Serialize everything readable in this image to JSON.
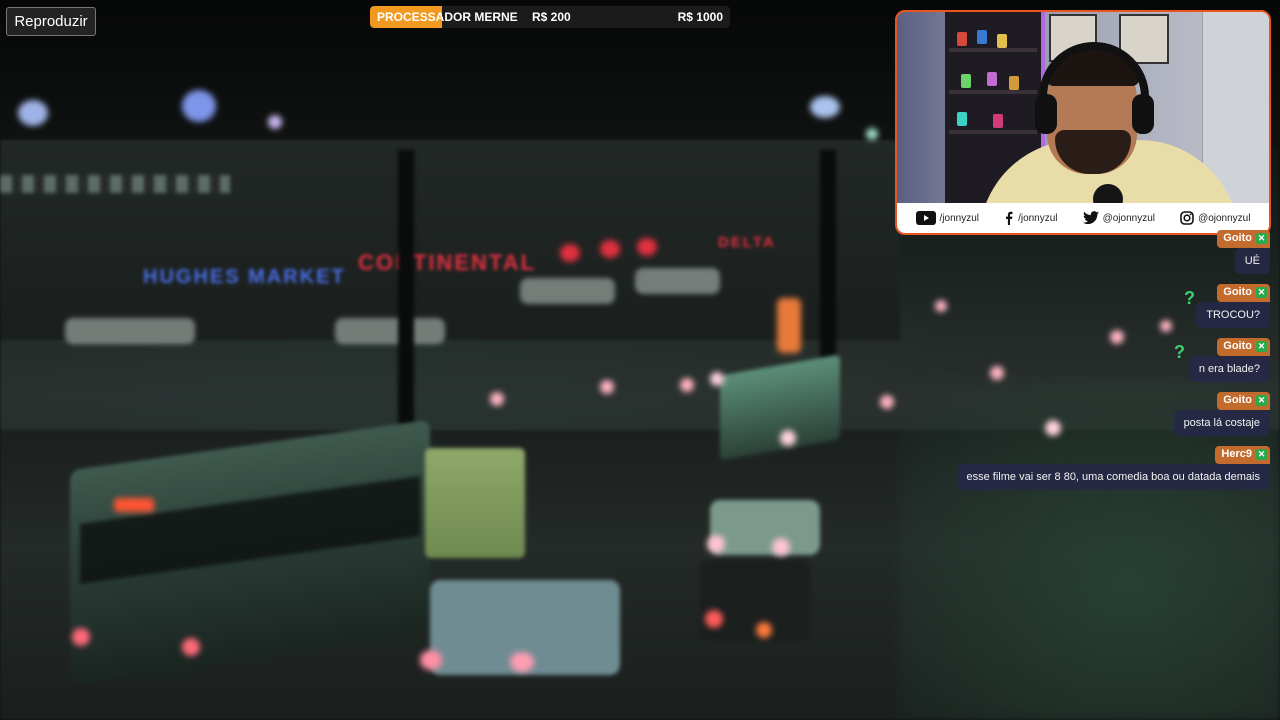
{
  "player": {
    "play_label": "Reproduzir"
  },
  "goal": {
    "name": "PROCESSADOR MERNE",
    "current": "R$ 200",
    "target": "R$ 1000",
    "progress": 0.2,
    "fill_color": "#f29a1f"
  },
  "webcam": {
    "border_color": "#e9541f",
    "socials": [
      {
        "icon": "youtube-icon",
        "handle": "/jonnyzul"
      },
      {
        "icon": "facebook-icon",
        "handle": "/jonnyzul"
      },
      {
        "icon": "twitter-icon",
        "handle": "@ojonnyzul"
      },
      {
        "icon": "instagram-icon",
        "handle": "@ojonnyzul"
      }
    ]
  },
  "chat": {
    "messages": [
      {
        "user": "Goito",
        "text": "UÉ"
      },
      {
        "user": "Goito",
        "text": "TROCOU?"
      },
      {
        "user": "Goito",
        "text": "n era blade?"
      },
      {
        "user": "Goito",
        "text": "posta lá costaje"
      },
      {
        "user": "Herc9",
        "text": "esse filme vai ser 8 80, uma comedia boa ou datada demais"
      }
    ]
  },
  "scene": {
    "signs": [
      "HUGHES MARKET",
      "CONTINENTAL",
      "DELTA"
    ]
  }
}
